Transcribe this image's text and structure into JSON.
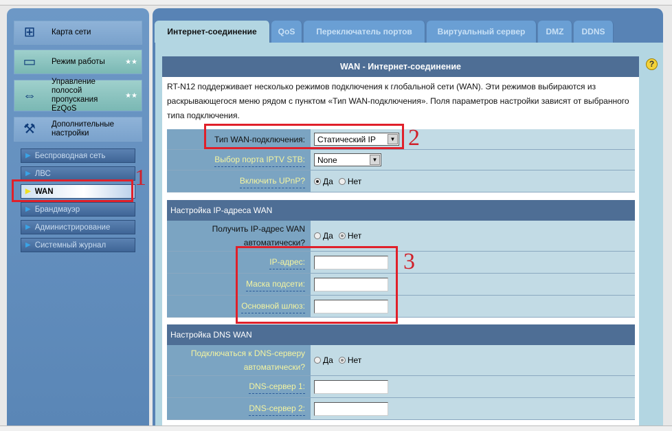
{
  "sidebar": {
    "menu": [
      {
        "label": "Карта сети",
        "icon": "network-map-icon"
      },
      {
        "label": "Режим работы",
        "icon": "router-icon"
      },
      {
        "label": "Управление полосой пропускания EzQoS",
        "icon": "bandwidth-icon"
      },
      {
        "label": "Дополнительные настройки",
        "icon": "tools-icon"
      }
    ],
    "submenu": [
      "Беспроводная сеть",
      "ЛВС",
      "WAN",
      "Брандмауэр",
      "Администрирование",
      "Системный журнал"
    ],
    "active": "WAN"
  },
  "tabs": [
    "Интернет-соединение",
    "QoS",
    "Переключатель портов",
    "Виртуальный сервер",
    "DMZ",
    "DDNS"
  ],
  "panel": {
    "title": "WAN - Интернет-соединение",
    "description": "RT-N12 поддерживает несколько режимов подключения к глобальной сети (WAN). Эти режимов выбираются из раскрывающегося меню рядом с пунктом «Тип WAN-подключения». Поля параметров настройки зависят от выбранного типа подключения.",
    "wan_type_label": "Тип WAN-подключения:",
    "wan_type_value": "Статический IP",
    "iptv_label": "Выбор порта IPTV STB:",
    "iptv_value": "None",
    "upnp_label": "Включить UPnP?",
    "yes": "Да",
    "no": "Нет",
    "ip_section": "Настройка IP-адреса WAN",
    "auto_ip_label": "Получить IP-адрес WAN автоматически?",
    "ip_label": "IP-адрес:",
    "mask_label": "Маска подсети:",
    "gateway_label": "Основной шлюз:",
    "dns_section": "Настройка DNS WAN",
    "auto_dns_label": "Подключаться к DNS-серверу автоматически?",
    "dns1_label": "DNS-сервер 1:",
    "dns2_label": "DNS-сервер 2:"
  },
  "annotations": [
    "1",
    "2",
    "3"
  ],
  "colors": {
    "annotation": "#e0202a",
    "header": "#4e6e95"
  }
}
